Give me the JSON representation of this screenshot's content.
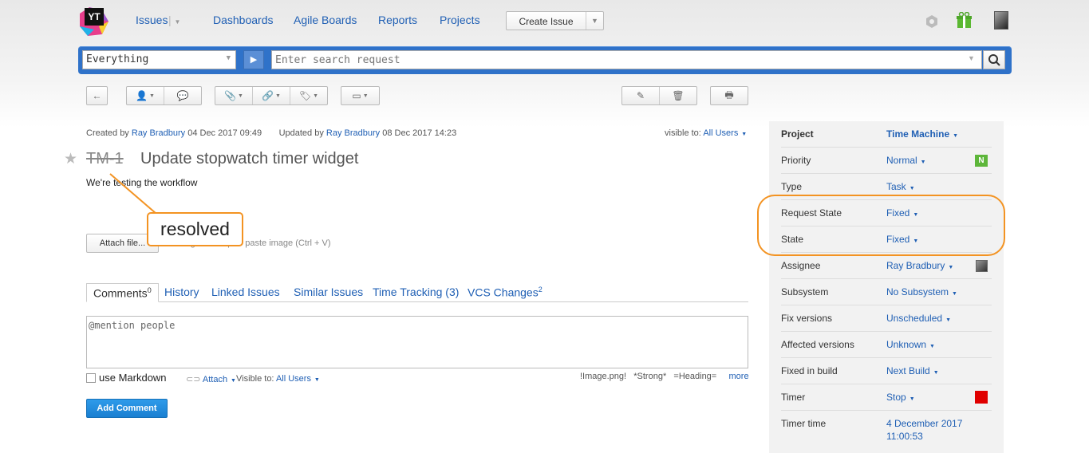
{
  "nav": {
    "logo_text": "YT",
    "issues": "Issues",
    "dashboards": "Dashboards",
    "agile_boards": "Agile Boards",
    "reports": "Reports",
    "projects": "Projects",
    "create_issue": "Create Issue"
  },
  "search": {
    "context": "Everything",
    "placeholder": "Enter search request"
  },
  "meta": {
    "created_by_label": "Created by",
    "created_by": "Ray Bradbury",
    "created_at": "04 Dec 2017 09:49",
    "updated_by_label": "Updated by",
    "updated_by": "Ray Bradbury",
    "updated_at": "08 Dec 2017 14:23",
    "visible_label": "visible to:",
    "visible_value": "All Users"
  },
  "issue": {
    "id": "TM-1",
    "title": "Update stopwatch timer widget",
    "description": "We're testing the workflow"
  },
  "attach": {
    "button": "Attach file...",
    "hint": "or drag and drop or paste image (Ctrl + V)"
  },
  "callout": "resolved",
  "tabs": [
    {
      "label": "Comments",
      "sup": "0"
    },
    {
      "label": "History"
    },
    {
      "label": "Linked Issues"
    },
    {
      "label": "Similar Issues"
    },
    {
      "label": "Time Tracking (3)"
    },
    {
      "label": "VCS Changes",
      "sup": "2"
    }
  ],
  "comment": {
    "placeholder": "@mention people",
    "markdown": "use Markdown",
    "attach": "Attach",
    "visible_label": "Visible to:",
    "visible_value": "All Users",
    "hints": "!Image.png!   *Strong*   =Heading=",
    "more": "more",
    "add_button": "Add Comment"
  },
  "fields": [
    {
      "name": "Project",
      "value": "Time Machine"
    },
    {
      "name": "Priority",
      "value": "Normal",
      "badge": "N"
    },
    {
      "name": "Type",
      "value": "Task"
    },
    {
      "name": "Request State",
      "value": "Fixed"
    },
    {
      "name": "State",
      "value": "Fixed"
    },
    {
      "name": "Assignee",
      "value": "Ray Bradbury"
    },
    {
      "name": "Subsystem",
      "value": "No Subsystem"
    },
    {
      "name": "Fix versions",
      "value": "Unscheduled"
    },
    {
      "name": "Affected versions",
      "value": "Unknown"
    },
    {
      "name": "Fixed in build",
      "value": "Next Build"
    },
    {
      "name": "Timer",
      "value": "Stop"
    },
    {
      "name": "Timer time",
      "value": "4 December 2017",
      "value2": "11:00:53"
    }
  ],
  "colors": {
    "accent": "#2f72c9",
    "link": "#1f5fb4",
    "callout": "#f39322",
    "priority_badge": "#5db63a",
    "timer_red": "#e00000"
  }
}
